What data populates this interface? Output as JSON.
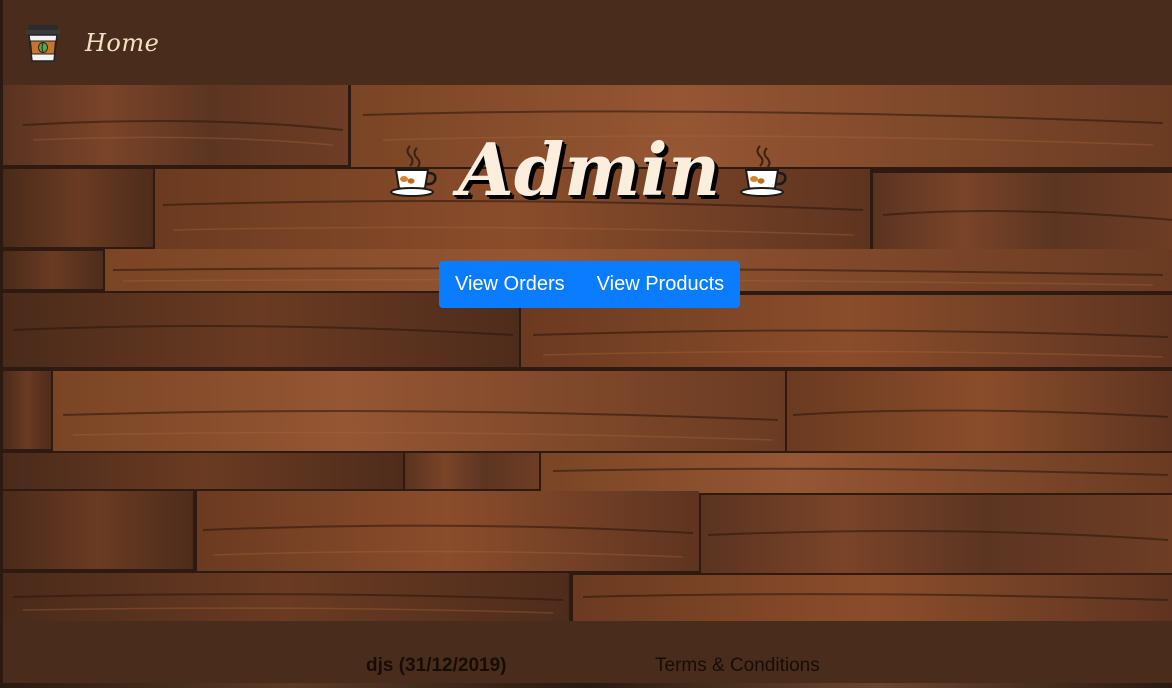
{
  "navbar": {
    "brand_icon": "coffee-cup-icon",
    "home_label": "Home"
  },
  "hero": {
    "title": "Admin",
    "left_icon": "coffee-cup-icon",
    "right_icon": "coffee-cup-icon",
    "background": "wood-planks-image",
    "buttons": {
      "view_orders": "View Orders",
      "view_products": "View Products"
    }
  },
  "footer": {
    "copyright": "djs (31/12/2019)",
    "terms": "Terms & Conditions"
  },
  "colors": {
    "nav_bg": "#4a2c1d",
    "button_bg": "#0a7cff",
    "title_text": "#fbeedd",
    "home_text": "#f2e2c4"
  }
}
